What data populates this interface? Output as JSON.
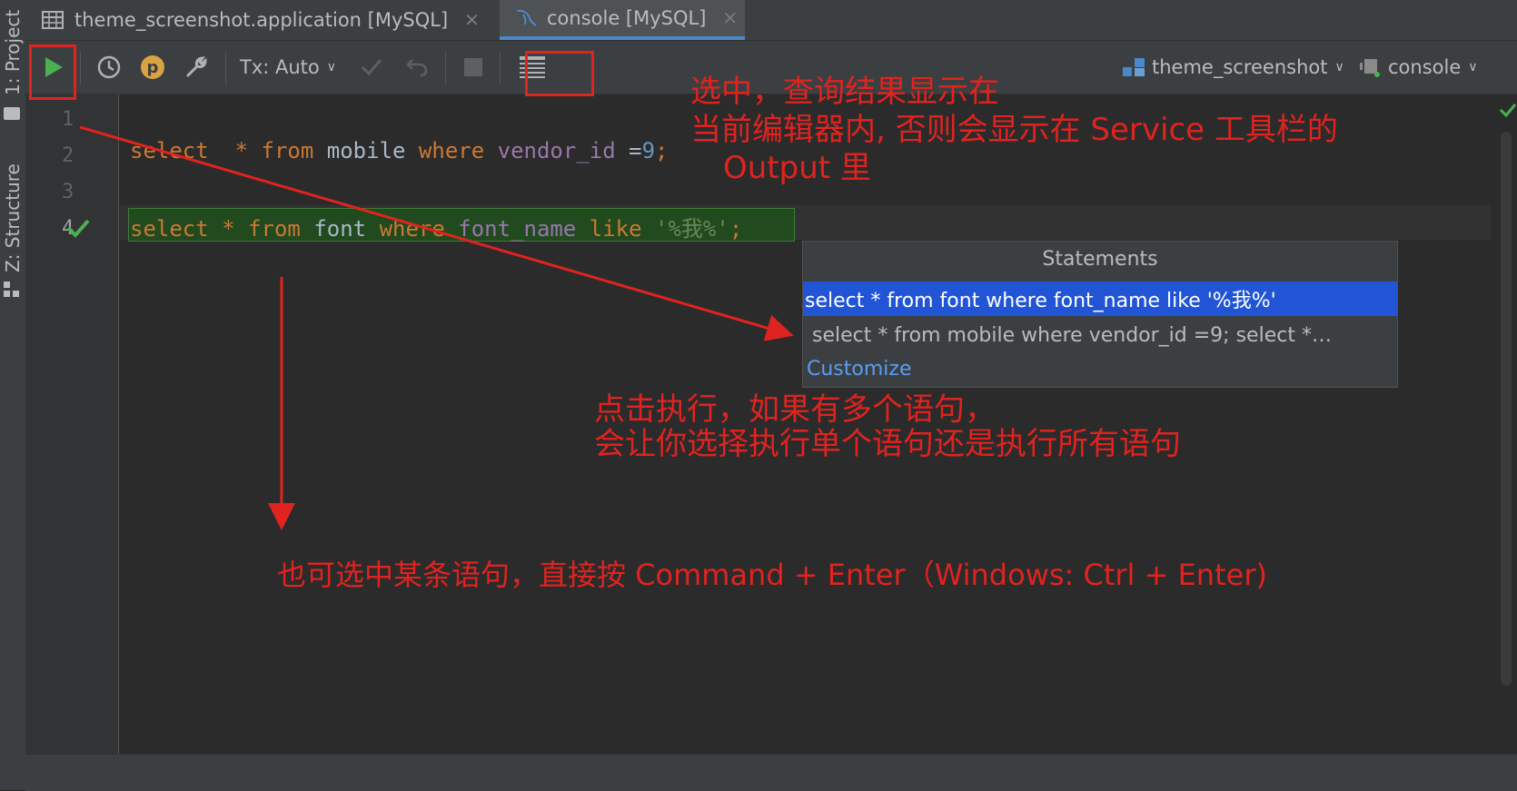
{
  "left_strip": {
    "project": "1: Project",
    "structure": "Z: Structure"
  },
  "tabs": [
    {
      "label": "theme_screenshot.application [MySQL]",
      "icon": "table-icon",
      "close": "✕"
    },
    {
      "label": "console [MySQL]",
      "icon": "mysql-dolphin-icon",
      "close": "✕"
    }
  ],
  "toolbar": {
    "tx_label": "Tx: Auto",
    "datasource": "theme_screenshot",
    "session": "console",
    "p_badge": "p"
  },
  "editor": {
    "lines": [
      "1",
      "2",
      "3",
      "4"
    ],
    "line2": {
      "kw_select": "select",
      "star": "*",
      "kw_from": "from",
      "table": "mobile",
      "kw_where": "where",
      "column": "vendor_id",
      "eq": "=",
      "num": "9",
      "semi": ";"
    },
    "line4": {
      "kw_select": "select",
      "star": "*",
      "kw_from": "from",
      "table": "font",
      "kw_where": "where",
      "column": "font_name",
      "kw_like": "like",
      "str": "'%我%'",
      "semi": ";"
    }
  },
  "popup": {
    "title": "Statements",
    "items": [
      "select * from font where font_name like '%我%'",
      "select * from mobile where vendor_id =9; select *…"
    ],
    "customize": "Customize"
  },
  "annotations": {
    "top_right": [
      "选中，查询结果显示在",
      "当前编辑器内, 否则会显示在 Service 工具栏的",
      "Output 里"
    ],
    "middle": [
      "点击执行，如果有多个语句，",
      "会让你选择执行单个语句还是执行所有语句"
    ],
    "bottom": "也可选中某条语句，直接按 Command + Enter（Windows: Ctrl + Enter)"
  },
  "colors": {
    "annotation_red": "#e0231f",
    "selection_blue": "#2255d6",
    "run_green": "#4caf50",
    "link_blue": "#589df6"
  }
}
